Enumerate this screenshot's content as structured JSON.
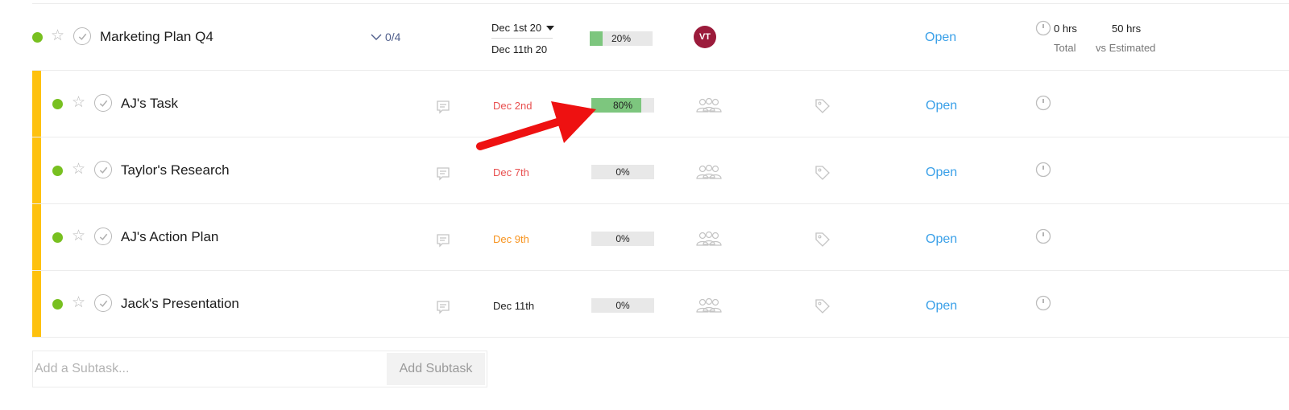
{
  "colors": {
    "accent_bar": "#fec10e",
    "dot_green": "#78c020",
    "progress_fill": "#7dc67e",
    "status_blue": "#3aa0e8",
    "avatar_bg": "#9b1b3b",
    "date_red": "#e84f4f",
    "date_orange": "#f7931e",
    "date_default": "#1c1c1c",
    "annotation_arrow": "#ee1111"
  },
  "parent_task": {
    "title": "Marketing Plan Q4",
    "subtask_count": "0/4",
    "start_date": "Dec 1st 20",
    "end_date": "Dec 11th 20",
    "progress": 20,
    "progress_label": "20%",
    "assignee_initials": "VT",
    "status": "Open",
    "time_total": "0 hrs",
    "time_total_label": "Total",
    "time_estimated": "50 hrs",
    "time_estimated_label": "vs Estimated"
  },
  "subtasks": [
    {
      "title": "AJ's Task",
      "due": "Dec 2nd",
      "due_color": "#e84f4f",
      "progress": 80,
      "progress_label": "80%",
      "status": "Open"
    },
    {
      "title": "Taylor's Research",
      "due": "Dec 7th",
      "due_color": "#e84f4f",
      "progress": 0,
      "progress_label": "0%",
      "status": "Open"
    },
    {
      "title": "AJ's Action Plan",
      "due": "Dec 9th",
      "due_color": "#f7931e",
      "progress": 0,
      "progress_label": "0%",
      "status": "Open"
    },
    {
      "title": "Jack's Presentation",
      "due": "Dec 11th",
      "due_color": "#1c1c1c",
      "progress": 0,
      "progress_label": "0%",
      "status": "Open"
    }
  ],
  "add_subtask": {
    "placeholder": "Add a Subtask...",
    "button_label": "Add Subtask"
  },
  "icons": {
    "star": "star-icon",
    "check": "check-circle-icon",
    "comment": "comment-icon",
    "team": "team-icon",
    "tag": "tag-icon",
    "clock": "clock-icon",
    "chevron": "chevron-down-icon",
    "caret": "caret-down-icon"
  }
}
